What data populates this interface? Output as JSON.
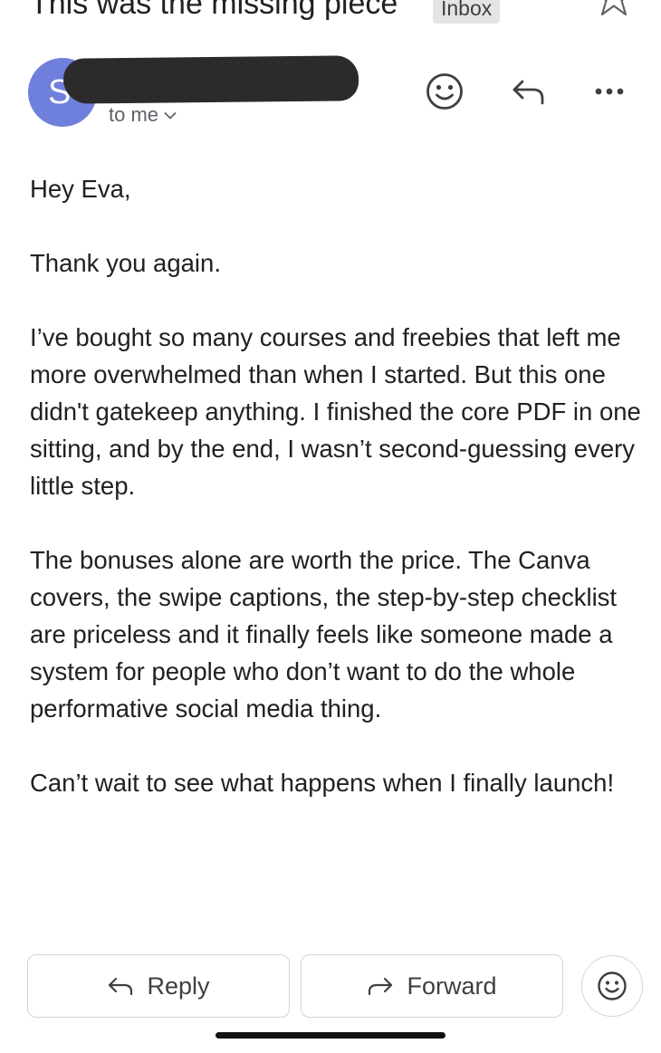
{
  "header": {
    "subject": "This was the missing piece",
    "label_badge": "Inbox",
    "star_icon": "star-outline-icon"
  },
  "sender": {
    "avatar_letter": "S",
    "recipient_text": "to me",
    "recipient_chevron_icon": "chevron-down-icon",
    "avatar_color": "#6f7fdc"
  },
  "actions": {
    "emoji_icon": "smiley-icon",
    "reply_icon": "reply-arrow-icon",
    "more_icon": "more-horizontal-icon"
  },
  "body": {
    "paragraphs": [
      "Hey Eva,",
      "Thank you again.",
      "I’ve bought so many courses and freebies that left me more overwhelmed than when I started. But this one didn't gatekeep anything. I finished the core PDF in one sitting, and by the end, I wasn’t second-guessing every little step.",
      "The bonuses alone are worth the price. The Canva covers, the swipe captions, the step-by-step checklist are priceless and it finally feels like someone made a system for people who don’t want to do the whole performative social media thing.",
      "Can’t wait to see what happens when I finally launch!"
    ]
  },
  "footer": {
    "reply_label": "Reply",
    "forward_label": "Forward",
    "emoji_react_icon": "smiley-icon"
  }
}
